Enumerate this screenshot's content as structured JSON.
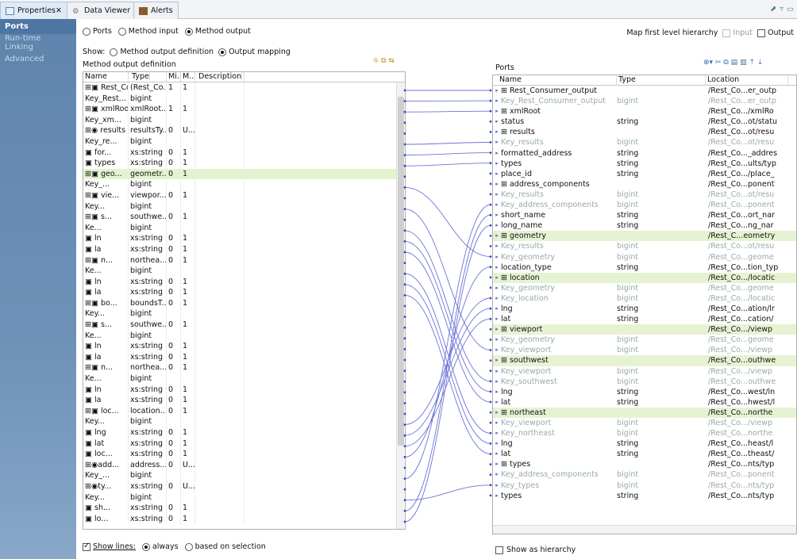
{
  "tabs": [
    "Properties",
    "Data Viewer",
    "Alerts"
  ],
  "sidebar": [
    "Ports",
    "Run-time Linking",
    "Advanced"
  ],
  "mode": {
    "ports": "Ports",
    "method_input": "Method input",
    "method_output": "Method output"
  },
  "map_first": "Map first level hierarchy",
  "map_input": "Input",
  "map_output": "Output",
  "show": {
    "label": "Show:",
    "opt1": "Method output definition",
    "opt2": "Output mapping"
  },
  "left_title": "Method output definition",
  "right_title": "Ports",
  "left_headers": [
    "Name",
    "Type",
    "Mi...",
    "M...",
    "Description"
  ],
  "right_headers": [
    "Name",
    "Type",
    "Location"
  ],
  "left_rows": [
    [
      "⊞▣ Rest_Co...",
      "(Rest_Co...",
      "1",
      "1"
    ],
    [
      "  Key_Rest...",
      "bigint",
      "",
      ""
    ],
    [
      "⊞▣ xmlRoot",
      "xmlRoot...",
      "1",
      "1"
    ],
    [
      "   Key_xm...",
      "bigint",
      "",
      ""
    ],
    [
      "  ⊞◉ results",
      "resultsTy...",
      "0",
      "U..."
    ],
    [
      "    Key_re...",
      "bigint",
      "",
      ""
    ],
    [
      "    ▣ for...",
      "xs:string",
      "0",
      "1"
    ],
    [
      "    ▣ types",
      "xs:string",
      "0",
      "1"
    ],
    [
      "   ⊞▣ geo...",
      "geometr...",
      "0",
      "1"
    ],
    [
      "     Key_...",
      "bigint",
      "",
      ""
    ],
    [
      "    ⊞▣ vie...",
      "viewpor...",
      "0",
      "1"
    ],
    [
      "      Key...",
      "bigint",
      "",
      ""
    ],
    [
      "     ⊞▣ s...",
      "southwe...",
      "0",
      "1"
    ],
    [
      "       Ke...",
      "bigint",
      "",
      ""
    ],
    [
      "       ▣ ln",
      "xs:string",
      "0",
      "1"
    ],
    [
      "       ▣ la",
      "xs:string",
      "0",
      "1"
    ],
    [
      "     ⊞▣ n...",
      "northea...",
      "0",
      "1"
    ],
    [
      "       Ke...",
      "bigint",
      "",
      ""
    ],
    [
      "       ▣ ln",
      "xs:string",
      "0",
      "1"
    ],
    [
      "       ▣ la",
      "xs:string",
      "0",
      "1"
    ],
    [
      "    ⊞▣ bo...",
      "boundsT...",
      "0",
      "1"
    ],
    [
      "      Key...",
      "bigint",
      "",
      ""
    ],
    [
      "     ⊞▣ s...",
      "southwe...",
      "0",
      "1"
    ],
    [
      "       Ke...",
      "bigint",
      "",
      ""
    ],
    [
      "       ▣ ln",
      "xs:string",
      "0",
      "1"
    ],
    [
      "       ▣ la",
      "xs:string",
      "0",
      "1"
    ],
    [
      "     ⊞▣ n...",
      "northea...",
      "0",
      "1"
    ],
    [
      "       Ke...",
      "bigint",
      "",
      ""
    ],
    [
      "       ▣ ln",
      "xs:string",
      "0",
      "1"
    ],
    [
      "       ▣ la",
      "xs:string",
      "0",
      "1"
    ],
    [
      "    ⊞▣ loc...",
      "location...",
      "0",
      "1"
    ],
    [
      "      Key...",
      "bigint",
      "",
      ""
    ],
    [
      "      ▣ lng",
      "xs:string",
      "0",
      "1"
    ],
    [
      "      ▣ lat",
      "xs:string",
      "0",
      "1"
    ],
    [
      "     ▣ loc...",
      "xs:string",
      "0",
      "1"
    ],
    [
      "  ⊞◉add...",
      "address...",
      "0",
      "U..."
    ],
    [
      "    Key_...",
      "bigint",
      "",
      ""
    ],
    [
      "   ⊞◉ty...",
      "xs:string",
      "0",
      "U..."
    ],
    [
      "     Key...",
      "bigint",
      "",
      ""
    ],
    [
      "    ▣ sh...",
      "xs:string",
      "0",
      "1"
    ],
    [
      "    ▣ lo...",
      "xs:string",
      "0",
      "1"
    ]
  ],
  "right_rows": [
    [
      "⊞ Rest_Consumer_output",
      "",
      "/Rest_Co...er_outp",
      "n"
    ],
    [
      "  Key_Rest_Consumer_output",
      "bigint",
      "/Rest_Co...er_outp",
      "g"
    ],
    [
      "⊞ xmlRoot",
      "",
      "/Rest_Co.../xmlRo",
      "n"
    ],
    [
      "  status",
      "string",
      "/Rest_Co...ot/statu",
      "n"
    ],
    [
      "⊞ results",
      "",
      "/Rest_Co...ot/resu",
      "n"
    ],
    [
      "  Key_results",
      "bigint",
      "/Rest_Co...ot/resu",
      "g"
    ],
    [
      "  formatted_address",
      "string",
      "/Rest_Co..._addres",
      "n"
    ],
    [
      "  types",
      "string",
      "/Rest_Co...ults/typ",
      "n"
    ],
    [
      "  place_id",
      "string",
      "/Rest_Co.../place_",
      "n"
    ],
    [
      "⊞ address_components",
      "",
      "/Rest_Co...ponent",
      "n"
    ],
    [
      "  Key_results",
      "bigint",
      "/Rest_Co...ot/resu",
      "g"
    ],
    [
      "  Key_address_components",
      "bigint",
      "/Rest_Co...ponent",
      "g"
    ],
    [
      "  short_name",
      "string",
      "/Rest_Co...ort_nar",
      "n"
    ],
    [
      "  long_name",
      "string",
      "/Rest_Co...ng_nar",
      "n"
    ],
    [
      "⊞ geometry",
      "",
      "/Rest_C...eometry",
      "h"
    ],
    [
      "  Key_results",
      "bigint",
      "/Rest_Co...ot/resu",
      "g"
    ],
    [
      "  Key_geometry",
      "bigint",
      "/Rest_Co...geome",
      "g"
    ],
    [
      "  location_type",
      "string",
      "/Rest_Co...tion_typ",
      "n"
    ],
    [
      "⊞ location",
      "",
      "/Rest_Co.../locatic",
      "h"
    ],
    [
      "  Key_geometry",
      "bigint",
      "/Rest_Co...geome",
      "g"
    ],
    [
      "  Key_location",
      "bigint",
      "/Rest_Co.../locatic",
      "g"
    ],
    [
      "  lng",
      "string",
      "/Rest_Co...ation/lr",
      "n"
    ],
    [
      "  lat",
      "string",
      "/Rest_Co...cation/",
      "n"
    ],
    [
      "⊞ viewport",
      "",
      "/Rest_Co.../viewp",
      "h"
    ],
    [
      "  Key_geometry",
      "bigint",
      "/Rest_Co...geome",
      "g"
    ],
    [
      "  Key_viewport",
      "bigint",
      "/Rest_Co.../viewp",
      "g"
    ],
    [
      "⊞ southwest",
      "",
      "/Rest_Co...outhwe",
      "h"
    ],
    [
      "  Key_viewport",
      "bigint",
      "/Rest_Co.../viewp",
      "g"
    ],
    [
      "  Key_southwest",
      "bigint",
      "/Rest_Co...outhwe",
      "g"
    ],
    [
      "  lng",
      "string",
      "/Rest_Co...west/ln",
      "n"
    ],
    [
      "  lat",
      "string",
      "/Rest_Co...hwest/l",
      "n"
    ],
    [
      "⊞ northeast",
      "",
      "/Rest_Co...northe",
      "h"
    ],
    [
      "  Key_viewport",
      "bigint",
      "/Rest_Co.../viewp",
      "g"
    ],
    [
      "  Key_northeast",
      "bigint",
      "/Rest_Co...northe",
      "g"
    ],
    [
      "  lng",
      "string",
      "/Rest_Co...heast/l",
      "n"
    ],
    [
      "  lat",
      "string",
      "/Rest_Co...theast/",
      "n"
    ],
    [
      "⊞ types",
      "",
      "/Rest_Co...nts/typ",
      "n"
    ],
    [
      "  Key_address_components",
      "bigint",
      "/Rest_Co...ponent",
      "g"
    ],
    [
      "  Key_types",
      "bigint",
      "/Rest_Co...nts/typ",
      "g"
    ],
    [
      "  types",
      "string",
      "/Rest_Co...nts/typ",
      "n"
    ]
  ],
  "show_lines": "Show lines:",
  "always": "always",
  "based": "based on selection",
  "show_hier": "Show as hierarchy"
}
